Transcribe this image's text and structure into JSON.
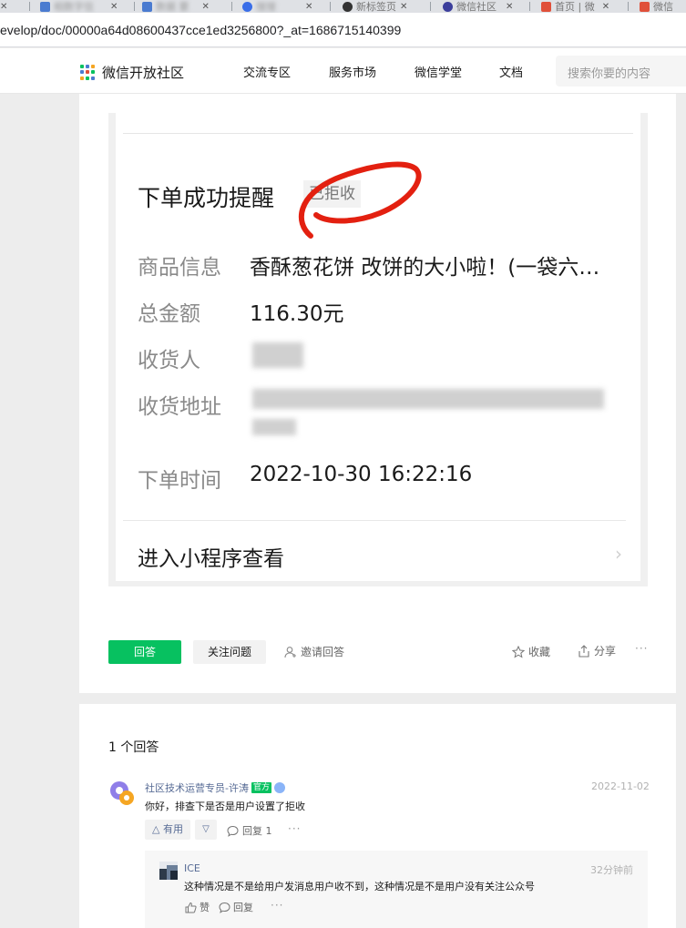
{
  "browser": {
    "tabs": [
      {
        "label": "",
        "favicon_color": "#e8e8e8"
      },
      {
        "label": "",
        "favicon_color": "#4a7bd0"
      },
      {
        "label": "",
        "favicon_color": "#4a7bd0"
      },
      {
        "label": "",
        "favicon_color": "#3a6ee8"
      },
      {
        "label": "新标签页",
        "favicon_color": "#333333"
      },
      {
        "label": "微信社区",
        "favicon_color": "#3c3f9c"
      },
      {
        "label": "首页 | 微",
        "favicon_color": "#e0503a"
      },
      {
        "label": "微信",
        "favicon_color": "#e0503a"
      }
    ],
    "url": "evelop/doc/00000a64d08600437cce1ed3256800?_at=1686715140399"
  },
  "site": {
    "name": "微信开放社区",
    "nav": [
      "交流专区",
      "服务市场",
      "微信学堂",
      "文档"
    ],
    "search_placeholder": "搜索你要的内容"
  },
  "question": {
    "screenshot": {
      "title": "下单成功提醒",
      "tag": "已拒收",
      "rows": [
        {
          "label": "商品信息",
          "value": "香酥葱花饼 改饼的大小啦！(一袋六…"
        },
        {
          "label": "总金额",
          "value": "116.30元"
        },
        {
          "label": "收货人",
          "value": ""
        },
        {
          "label": "收货地址",
          "value": ""
        },
        {
          "label": "下单时间",
          "value": "2022-10-30 16:22:16"
        }
      ],
      "enter_label": "进入小程序查看",
      "annotation_color": "#e32010"
    },
    "actions": {
      "answer": "回答",
      "follow": "关注问题",
      "invite": "邀请回答",
      "favorite": "收藏",
      "share": "分享",
      "more": "···"
    }
  },
  "answers": {
    "count_label": "1 个回答",
    "items": [
      {
        "author": "社区技术运营专员-许涛",
        "badge": "官方",
        "date": "2022-11-02",
        "content": "你好，排查下是否是用户设置了拒收",
        "useful": "有用",
        "reply": "回复 1",
        "more": "···",
        "replies": [
          {
            "name": "ICE",
            "time": "32分钟前",
            "content": "这种情况是不是给用户发消息用户收不到，这种情况是不是用户没有关注公众号",
            "like": "赞",
            "reply": "回复",
            "more": "···"
          }
        ]
      }
    ]
  },
  "colors": {
    "accent": "#07c160",
    "link": "#576b95",
    "annotation": "#e32010"
  }
}
